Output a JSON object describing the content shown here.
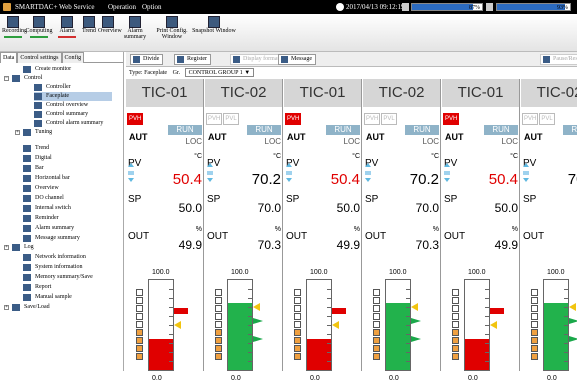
{
  "topbar": {
    "app_title": "SMARTDAC+ Web Service",
    "menu": [
      "Operation",
      "Option"
    ],
    "datetime": "2017/04/13 09:12:19",
    "bars": [
      {
        "label": "87%",
        "value": 87
      },
      {
        "label": "93%",
        "value": 93
      }
    ]
  },
  "toolbar": [
    {
      "label": "Recording",
      "icon": "recording-icon",
      "underline": "#2e9e3e"
    },
    {
      "label": "Computing",
      "icon": "computing-icon",
      "underline": "#2e9e3e"
    },
    {
      "label": "Alarm",
      "icon": "alarm-icon",
      "underline": "#d32f2f"
    },
    {
      "label": "Trend",
      "icon": "trend-icon",
      "underline": ""
    },
    {
      "label": "Overview",
      "icon": "overview-icon",
      "underline": ""
    },
    {
      "label": "Alarm summary",
      "icon": "alarm-summary-icon",
      "underline": ""
    },
    {
      "label": "Print Config. Window",
      "icon": "printer-icon",
      "underline": ""
    },
    {
      "label": "Snapshot Window",
      "icon": "camera-icon",
      "underline": ""
    }
  ],
  "sidebar": {
    "tabs": [
      "Data",
      "Control settings",
      "Config"
    ],
    "items": [
      {
        "label": "Create monitor",
        "indent": 1,
        "icon": "create-monitor-icon"
      },
      {
        "label": "Control",
        "indent": 0,
        "icon": "control-icon",
        "expander": "−"
      },
      {
        "label": "Controller",
        "indent": 2,
        "icon": "controller-icon"
      },
      {
        "label": "Faceplate",
        "indent": 2,
        "icon": "faceplate-icon",
        "selected": true
      },
      {
        "label": "Control overview",
        "indent": 2,
        "icon": "control-overview-icon"
      },
      {
        "label": "Control summary",
        "indent": 2,
        "icon": "control-summary-icon"
      },
      {
        "label": "Control alarm summary",
        "indent": 2,
        "icon": "control-alarm-summary-icon"
      },
      {
        "label": "Tuning",
        "indent": 1,
        "icon": "tuning-icon",
        "expander": "+"
      },
      {
        "label": "Trend",
        "indent": 1,
        "icon": "trend-icon"
      },
      {
        "label": "Digital",
        "indent": 1,
        "icon": "digital-icon"
      },
      {
        "label": "Bar",
        "indent": 1,
        "icon": "bar-icon"
      },
      {
        "label": "Horizontal bar",
        "indent": 1,
        "icon": "horizontal-bar-icon"
      },
      {
        "label": "Overview",
        "indent": 1,
        "icon": "overview-icon"
      },
      {
        "label": "DO channel",
        "indent": 1,
        "icon": "do-channel-icon"
      },
      {
        "label": "Internal switch",
        "indent": 1,
        "icon": "internal-switch-icon"
      },
      {
        "label": "Reminder",
        "indent": 1,
        "icon": "reminder-icon"
      },
      {
        "label": "Alarm summary",
        "indent": 1,
        "icon": "alarm-summary-icon"
      },
      {
        "label": "Message summary",
        "indent": 1,
        "icon": "message-summary-icon"
      },
      {
        "label": "Log",
        "indent": 0,
        "icon": "log-icon",
        "expander": "+"
      },
      {
        "label": "Network information",
        "indent": 1,
        "icon": "network-icon"
      },
      {
        "label": "System information",
        "indent": 1,
        "icon": "system-icon"
      },
      {
        "label": "Memory summary/Save",
        "indent": 1,
        "icon": "memory-icon"
      },
      {
        "label": "Report",
        "indent": 1,
        "icon": "report-icon"
      },
      {
        "label": "Manual sample",
        "indent": 1,
        "icon": "manual-sample-icon"
      },
      {
        "label": "Save/Load",
        "indent": 0,
        "icon": "save-load-icon",
        "expander": "+"
      }
    ]
  },
  "main": {
    "toolbar": [
      {
        "label": "Divide",
        "disabled": false
      },
      {
        "label": "Register",
        "disabled": false
      },
      {
        "label": "Display format",
        "disabled": true
      },
      {
        "label": "Message",
        "disabled": false
      }
    ],
    "right_button": "Pause/Resume",
    "type_label": "Type: Faceplate",
    "group_label": "Gr.",
    "group_value": "CONTROL GROUP 1 ▼",
    "panels": [
      {
        "tag": "TIC-01",
        "alarms": [
          {
            "t": "PVH",
            "on": true
          }
        ],
        "pv": "50.4",
        "pv_red": true,
        "sp": "50.0",
        "out": "49.9",
        "fill": 0.35,
        "color": "red"
      },
      {
        "tag": "TIC-02",
        "alarms": [
          {
            "t": "PVH",
            "on": false
          },
          {
            "t": "PVL",
            "on": false
          }
        ],
        "pv": "70.2",
        "pv_red": false,
        "sp": "70.0",
        "out": "70.3",
        "fill": 0.75,
        "color": "grn"
      },
      {
        "tag": "TIC-01",
        "alarms": [
          {
            "t": "PVH",
            "on": true
          }
        ],
        "pv": "50.4",
        "pv_red": true,
        "sp": "50.0",
        "out": "49.9",
        "fill": 0.35,
        "color": "red"
      },
      {
        "tag": "TIC-02",
        "alarms": [
          {
            "t": "PVH",
            "on": false
          },
          {
            "t": "PVL",
            "on": false
          }
        ],
        "pv": "70.2",
        "pv_red": false,
        "sp": "70.0",
        "out": "70.3",
        "fill": 0.75,
        "color": "grn"
      },
      {
        "tag": "TIC-01",
        "alarms": [
          {
            "t": "PVH",
            "on": true
          }
        ],
        "pv": "50.4",
        "pv_red": true,
        "sp": "50.0",
        "out": "49.9",
        "fill": 0.35,
        "color": "red"
      },
      {
        "tag": "TIC-02",
        "alarms": [
          {
            "t": "PVH",
            "on": false
          },
          {
            "t": "PVL",
            "on": false
          }
        ],
        "pv": "70.2",
        "pv_red": false,
        "sp": "70.",
        "out": "70.",
        "fill": 0.75,
        "color": "grn"
      }
    ],
    "mode_aut": "AUT",
    "mode_run": "RUN",
    "mode_loc": "LOC",
    "pv_label": "PV",
    "sp_label": "SP",
    "out_label": "OUT",
    "unit_c": "°C",
    "unit_pct": "%",
    "bar_top": "100.0",
    "bar_bottom": "0.0"
  }
}
